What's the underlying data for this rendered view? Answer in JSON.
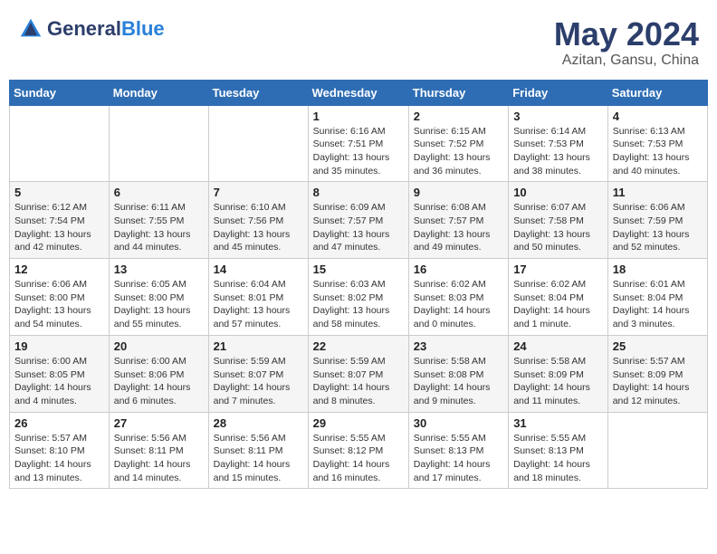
{
  "header": {
    "logo_general": "General",
    "logo_blue": "Blue",
    "month_year": "May 2024",
    "location": "Azitan, Gansu, China"
  },
  "days_of_week": [
    "Sunday",
    "Monday",
    "Tuesday",
    "Wednesday",
    "Thursday",
    "Friday",
    "Saturday"
  ],
  "weeks": [
    [
      {
        "day": "",
        "info": ""
      },
      {
        "day": "",
        "info": ""
      },
      {
        "day": "",
        "info": ""
      },
      {
        "day": "1",
        "info": "Sunrise: 6:16 AM\nSunset: 7:51 PM\nDaylight: 13 hours and 35 minutes."
      },
      {
        "day": "2",
        "info": "Sunrise: 6:15 AM\nSunset: 7:52 PM\nDaylight: 13 hours and 36 minutes."
      },
      {
        "day": "3",
        "info": "Sunrise: 6:14 AM\nSunset: 7:53 PM\nDaylight: 13 hours and 38 minutes."
      },
      {
        "day": "4",
        "info": "Sunrise: 6:13 AM\nSunset: 7:53 PM\nDaylight: 13 hours and 40 minutes."
      }
    ],
    [
      {
        "day": "5",
        "info": "Sunrise: 6:12 AM\nSunset: 7:54 PM\nDaylight: 13 hours and 42 minutes."
      },
      {
        "day": "6",
        "info": "Sunrise: 6:11 AM\nSunset: 7:55 PM\nDaylight: 13 hours and 44 minutes."
      },
      {
        "day": "7",
        "info": "Sunrise: 6:10 AM\nSunset: 7:56 PM\nDaylight: 13 hours and 45 minutes."
      },
      {
        "day": "8",
        "info": "Sunrise: 6:09 AM\nSunset: 7:57 PM\nDaylight: 13 hours and 47 minutes."
      },
      {
        "day": "9",
        "info": "Sunrise: 6:08 AM\nSunset: 7:57 PM\nDaylight: 13 hours and 49 minutes."
      },
      {
        "day": "10",
        "info": "Sunrise: 6:07 AM\nSunset: 7:58 PM\nDaylight: 13 hours and 50 minutes."
      },
      {
        "day": "11",
        "info": "Sunrise: 6:06 AM\nSunset: 7:59 PM\nDaylight: 13 hours and 52 minutes."
      }
    ],
    [
      {
        "day": "12",
        "info": "Sunrise: 6:06 AM\nSunset: 8:00 PM\nDaylight: 13 hours and 54 minutes."
      },
      {
        "day": "13",
        "info": "Sunrise: 6:05 AM\nSunset: 8:00 PM\nDaylight: 13 hours and 55 minutes."
      },
      {
        "day": "14",
        "info": "Sunrise: 6:04 AM\nSunset: 8:01 PM\nDaylight: 13 hours and 57 minutes."
      },
      {
        "day": "15",
        "info": "Sunrise: 6:03 AM\nSunset: 8:02 PM\nDaylight: 13 hours and 58 minutes."
      },
      {
        "day": "16",
        "info": "Sunrise: 6:02 AM\nSunset: 8:03 PM\nDaylight: 14 hours and 0 minutes."
      },
      {
        "day": "17",
        "info": "Sunrise: 6:02 AM\nSunset: 8:04 PM\nDaylight: 14 hours and 1 minute."
      },
      {
        "day": "18",
        "info": "Sunrise: 6:01 AM\nSunset: 8:04 PM\nDaylight: 14 hours and 3 minutes."
      }
    ],
    [
      {
        "day": "19",
        "info": "Sunrise: 6:00 AM\nSunset: 8:05 PM\nDaylight: 14 hours and 4 minutes."
      },
      {
        "day": "20",
        "info": "Sunrise: 6:00 AM\nSunset: 8:06 PM\nDaylight: 14 hours and 6 minutes."
      },
      {
        "day": "21",
        "info": "Sunrise: 5:59 AM\nSunset: 8:07 PM\nDaylight: 14 hours and 7 minutes."
      },
      {
        "day": "22",
        "info": "Sunrise: 5:59 AM\nSunset: 8:07 PM\nDaylight: 14 hours and 8 minutes."
      },
      {
        "day": "23",
        "info": "Sunrise: 5:58 AM\nSunset: 8:08 PM\nDaylight: 14 hours and 9 minutes."
      },
      {
        "day": "24",
        "info": "Sunrise: 5:58 AM\nSunset: 8:09 PM\nDaylight: 14 hours and 11 minutes."
      },
      {
        "day": "25",
        "info": "Sunrise: 5:57 AM\nSunset: 8:09 PM\nDaylight: 14 hours and 12 minutes."
      }
    ],
    [
      {
        "day": "26",
        "info": "Sunrise: 5:57 AM\nSunset: 8:10 PM\nDaylight: 14 hours and 13 minutes."
      },
      {
        "day": "27",
        "info": "Sunrise: 5:56 AM\nSunset: 8:11 PM\nDaylight: 14 hours and 14 minutes."
      },
      {
        "day": "28",
        "info": "Sunrise: 5:56 AM\nSunset: 8:11 PM\nDaylight: 14 hours and 15 minutes."
      },
      {
        "day": "29",
        "info": "Sunrise: 5:55 AM\nSunset: 8:12 PM\nDaylight: 14 hours and 16 minutes."
      },
      {
        "day": "30",
        "info": "Sunrise: 5:55 AM\nSunset: 8:13 PM\nDaylight: 14 hours and 17 minutes."
      },
      {
        "day": "31",
        "info": "Sunrise: 5:55 AM\nSunset: 8:13 PM\nDaylight: 14 hours and 18 minutes."
      },
      {
        "day": "",
        "info": ""
      }
    ]
  ]
}
